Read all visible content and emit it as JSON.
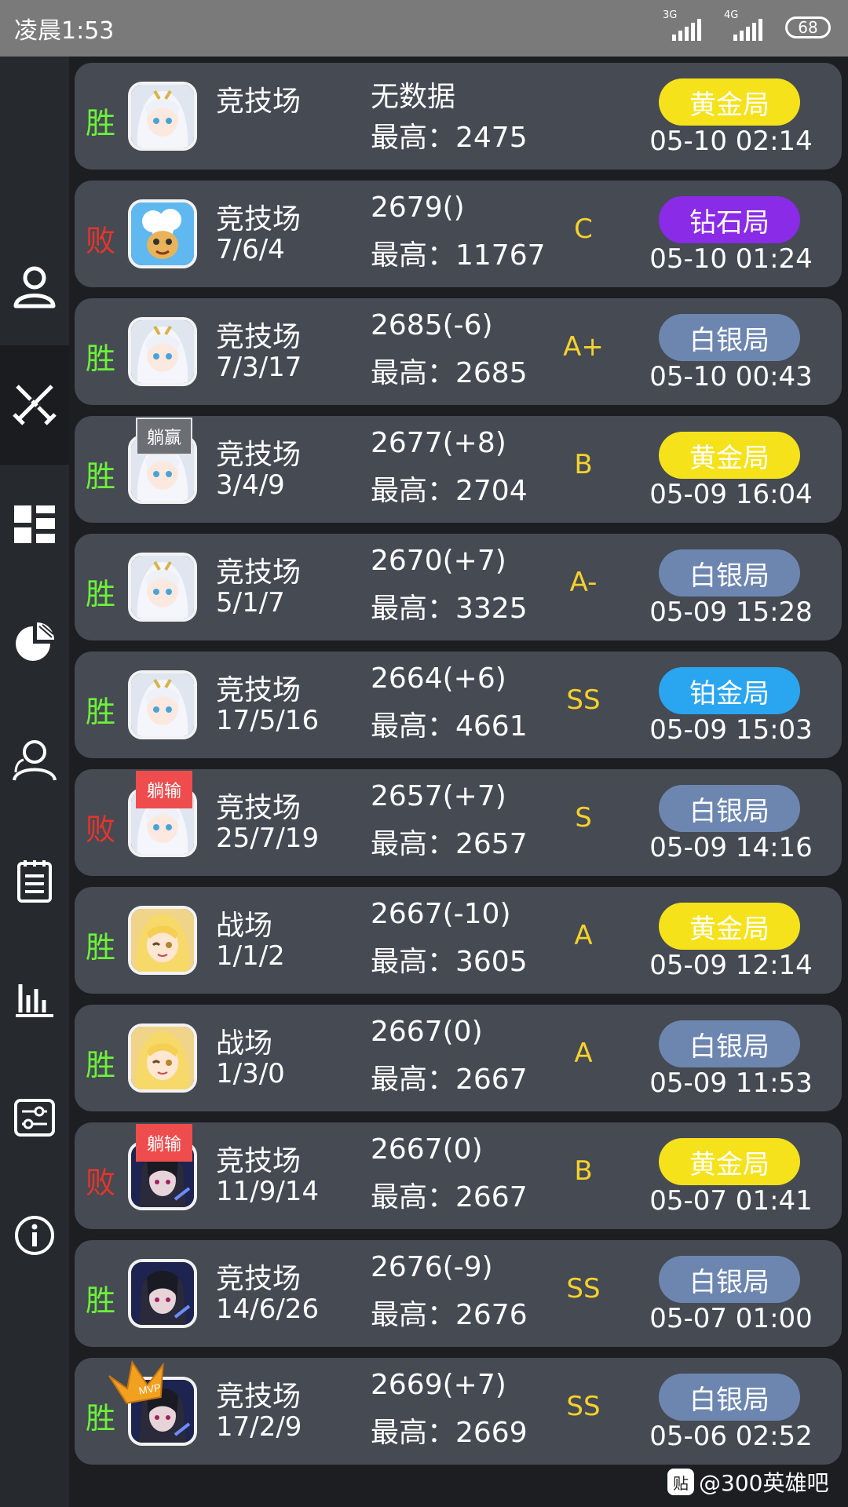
{
  "status_bar": {
    "time": "凌晨1:53",
    "net1": "3G",
    "net2": "4G",
    "battery": "68"
  },
  "tiers": {
    "黄金局": "#f5e21b",
    "钻石局": "#8a2be8",
    "白银局": "#6d86b0",
    "铂金局": "#2aa5f0"
  },
  "matches": [
    {
      "result": "胜",
      "mode": "竞技场",
      "kda": "",
      "score": "无数据",
      "best": "最高：2475",
      "grade": "",
      "tier": "黄金局",
      "date": "05-10 02:14",
      "avatar": "white",
      "badge": ""
    },
    {
      "result": "败",
      "mode": "竞技场",
      "kda": "7/6/4",
      "score": "2679()",
      "best": "最高：11767",
      "grade": "C",
      "tier": "钻石局",
      "date": "05-10 01:24",
      "avatar": "sheep",
      "badge": ""
    },
    {
      "result": "胜",
      "mode": "竞技场",
      "kda": "7/3/17",
      "score": "2685(-6)",
      "best": "最高：2685",
      "grade": "A+",
      "tier": "白银局",
      "date": "05-10 00:43",
      "avatar": "white",
      "badge": ""
    },
    {
      "result": "胜",
      "mode": "竞技场",
      "kda": "3/4/9",
      "score": "2677(+8)",
      "best": "最高：2704",
      "grade": "B",
      "tier": "黄金局",
      "date": "05-09 16:04",
      "avatar": "white",
      "badge": "躺赢"
    },
    {
      "result": "胜",
      "mode": "竞技场",
      "kda": "5/1/7",
      "score": "2670(+7)",
      "best": "最高：3325",
      "grade": "A-",
      "tier": "白银局",
      "date": "05-09 15:28",
      "avatar": "white",
      "badge": ""
    },
    {
      "result": "胜",
      "mode": "竞技场",
      "kda": "17/5/16",
      "score": "2664(+6)",
      "best": "最高：4661",
      "grade": "SS",
      "tier": "铂金局",
      "date": "05-09 15:03",
      "avatar": "white",
      "badge": ""
    },
    {
      "result": "败",
      "mode": "竞技场",
      "kda": "25/7/19",
      "score": "2657(+7)",
      "best": "最高：2657",
      "grade": "S",
      "tier": "白银局",
      "date": "05-09 14:16",
      "avatar": "white",
      "badge": "躺输"
    },
    {
      "result": "胜",
      "mode": "战场",
      "kda": "1/1/2",
      "score": "2667(-10)",
      "best": "最高：3605",
      "grade": "A",
      "tier": "黄金局",
      "date": "05-09 12:14",
      "avatar": "blonde",
      "badge": ""
    },
    {
      "result": "胜",
      "mode": "战场",
      "kda": "1/3/0",
      "score": "2667(0)",
      "best": "最高：2667",
      "grade": "A",
      "tier": "白银局",
      "date": "05-09 11:53",
      "avatar": "blonde",
      "badge": ""
    },
    {
      "result": "败",
      "mode": "竞技场",
      "kda": "11/9/14",
      "score": "2667(0)",
      "best": "最高：2667",
      "grade": "B",
      "tier": "黄金局",
      "date": "05-07 01:41",
      "avatar": "dark",
      "badge": "躺输"
    },
    {
      "result": "胜",
      "mode": "竞技场",
      "kda": "14/6/26",
      "score": "2676(-9)",
      "best": "最高：2676",
      "grade": "SS",
      "tier": "白银局",
      "date": "05-07 01:00",
      "avatar": "dark",
      "badge": ""
    },
    {
      "result": "胜",
      "mode": "竞技场",
      "kda": "17/2/9",
      "score": "2669(+7)",
      "best": "最高：2669",
      "grade": "SS",
      "tier": "白银局",
      "date": "05-06 02:52",
      "avatar": "dark",
      "badge": "MVP"
    }
  ],
  "sidebar": {
    "icons": [
      "user-icon",
      "crossed-swords-icon",
      "dashboard-icon",
      "pie-chart-icon",
      "friends-icon",
      "notes-icon",
      "bar-chart-icon",
      "settings-icon",
      "info-icon"
    ]
  },
  "watermark": {
    "text": "@300英雄吧",
    "logo": "贴"
  }
}
